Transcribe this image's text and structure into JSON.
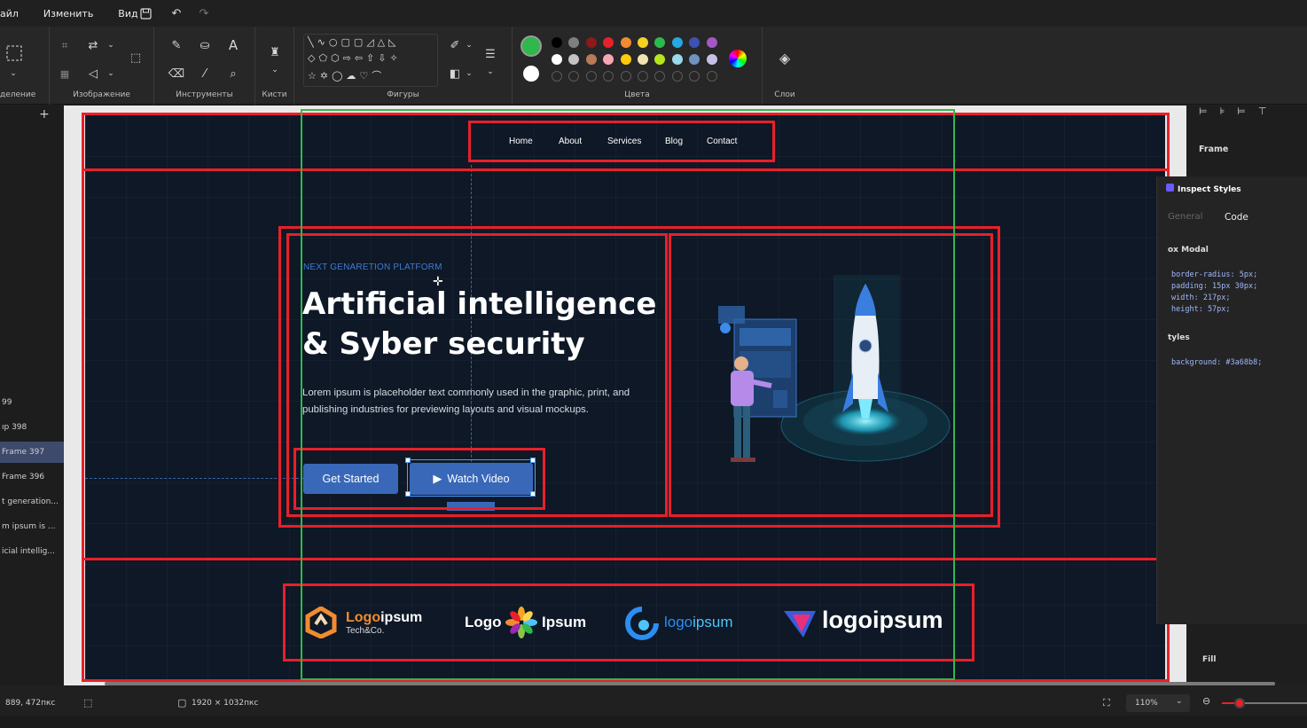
{
  "menu": {
    "file": "айл",
    "edit": "Изменить",
    "view": "Вид"
  },
  "ribbon": {
    "groups": {
      "selection": "деление",
      "image": "Изображение",
      "tools": "Инструменты",
      "brushes": "Кисти",
      "shapes": "Фигуры",
      "colors": "Цвета",
      "layers": "Слои"
    },
    "palette_row1": [
      "#000000",
      "#7f7f7f",
      "#8b1a1a",
      "#e8202a",
      "#f28b30",
      "#f5d020",
      "#2fb84b",
      "#27a7e0",
      "#3f51b5",
      "#a259c4"
    ],
    "palette_row2": [
      "#ffffff",
      "#c3c3c3",
      "#b97a57",
      "#f5a6b5",
      "#ffc90e",
      "#efe4b0",
      "#b5e61d",
      "#99d9ea",
      "#7092be",
      "#c8bfe7"
    ],
    "primary_color": "#2fb84b",
    "secondary_color": "#ffffff"
  },
  "layers_panel": {
    "items": [
      "99",
      "ıp 398",
      "Frame 397",
      "Frame 396",
      "t generation...",
      "m ipsum is ...",
      "icial intellig..."
    ],
    "selected": "Frame 397"
  },
  "design": {
    "nav": [
      "Home",
      "About",
      "Services",
      "Blog",
      "Contact"
    ],
    "tagline": "NEXT GENARETION PLATFORM",
    "headline_line1": "Artificial intelligence",
    "headline_line2": "& Syber security",
    "body": "Lorem ipsum is placeholder text commonly used in the graphic, print, and publishing industries for previewing layouts and visual mockups.",
    "btn_primary": "Get Started",
    "btn_secondary": "Watch Video",
    "logos": [
      {
        "bold": "Logo",
        "rest": "ipsum",
        "sub": "Tech&Co."
      },
      {
        "left": "Logo",
        "right": "Ipsum"
      },
      {
        "text_a": "logo",
        "text_b": "ipsum"
      },
      {
        "text": "logoipsum"
      }
    ]
  },
  "inspector": {
    "frame_label": "Frame",
    "title": "Inspect Styles",
    "tab_general": "General",
    "tab_code": "Code",
    "box_model": "ox Modal",
    "css": [
      "border-radius: 5px;",
      "padding: 15px 30px;",
      "width: 217px;",
      "height: 57px;"
    ],
    "styles": "tyles",
    "background": "background: #3a68b8;",
    "fill": "Fill"
  },
  "status": {
    "cursor": "889, 472пкс",
    "size": "1920 × 1032пкс",
    "zoom": "110%"
  },
  "colors": {
    "accent": "#3a68b8",
    "frame_red": "#e8202a",
    "guide_green": "#2fb84b",
    "design_bg": "#0e1826"
  }
}
